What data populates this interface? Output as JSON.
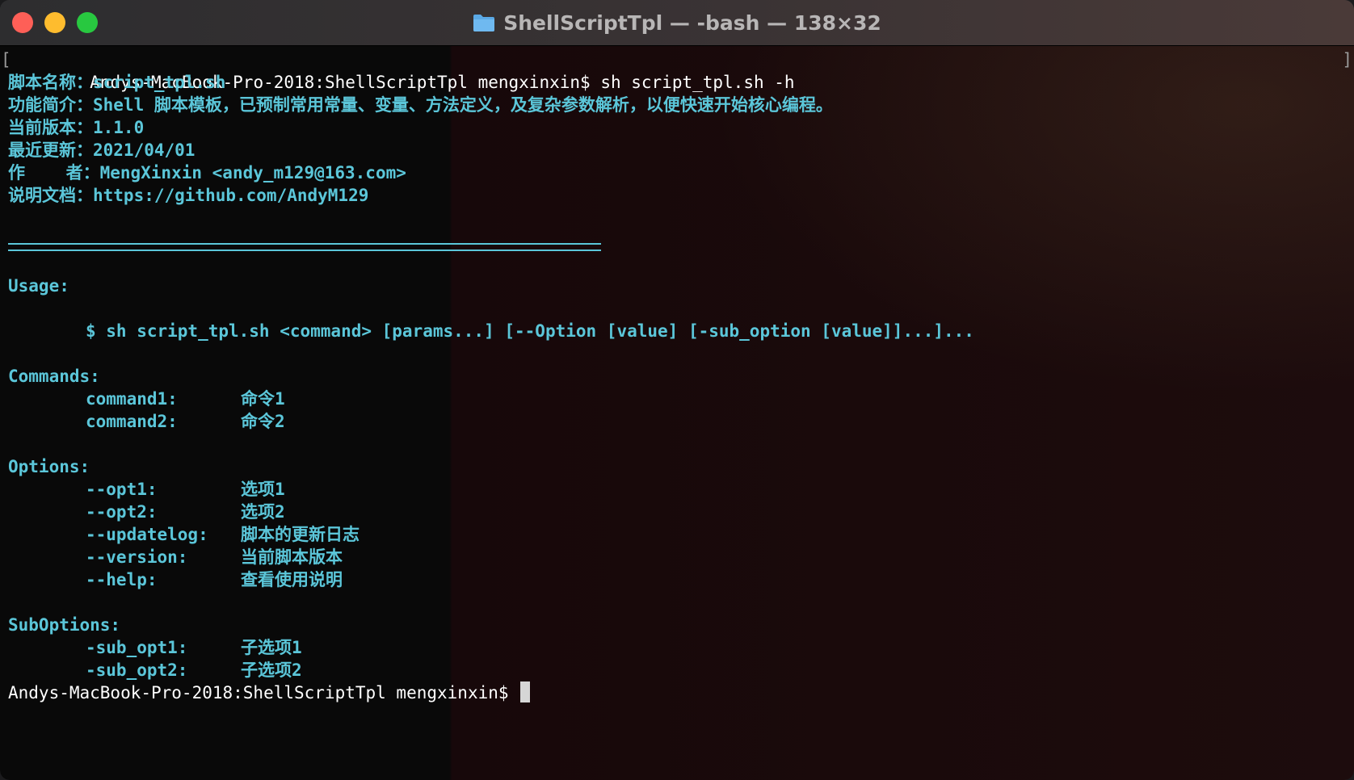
{
  "window": {
    "title": "ShellScriptTpl — -bash — 138×32",
    "folder_icon": "folder-icon"
  },
  "terminal": {
    "command_line": {
      "prompt": "Andys-MacBook-Pro-2018:ShellScriptTpl mengxinxin$",
      "command": " sh script_tpl.sh -h"
    },
    "info": [
      {
        "label": "脚本名称：",
        "value": "script_tpl.sh"
      },
      {
        "label": "功能简介：",
        "value": "Shell 脚本模板，已预制常用常量、变量、方法定义，及复杂参数解析，以便快速开始核心编程。"
      },
      {
        "label": "当前版本：",
        "value": "1.1.0"
      },
      {
        "label": "最近更新：",
        "value": "2021/04/01"
      },
      {
        "label": "作    者：",
        "value": "MengXinxin <andy_m129@163.com>"
      },
      {
        "label": "说明文档：",
        "value": "https://github.com/AndyM129"
      }
    ],
    "usage_heading": "Usage:",
    "usage_line": "$ sh script_tpl.sh <command> [params...] [--Option [value] [-sub_option [value]]...]...",
    "commands_heading": "Commands:",
    "commands": [
      {
        "key": "command1:",
        "desc": "命令1"
      },
      {
        "key": "command2:",
        "desc": "命令2"
      }
    ],
    "options_heading": "Options:",
    "options": [
      {
        "key": "--opt1:",
        "desc": "选项1"
      },
      {
        "key": "--opt2:",
        "desc": "选项2"
      },
      {
        "key": "--updatelog:",
        "desc": "脚本的更新日志"
      },
      {
        "key": "--version:",
        "desc": "当前脚本版本"
      },
      {
        "key": "--help:",
        "desc": "查看使用说明"
      }
    ],
    "suboptions_heading": "SubOptions:",
    "suboptions": [
      {
        "key": "-sub_opt1:",
        "desc": "子选项1"
      },
      {
        "key": "-sub_opt2:",
        "desc": "子选项2"
      }
    ],
    "final_prompt": "Andys-MacBook-Pro-2018:ShellScriptTpl mengxinxin$ "
  },
  "colors": {
    "accent_cyan": "#5bc6d9",
    "close": "#fe5f57",
    "minimize": "#febc2e",
    "maximize": "#28c840"
  }
}
